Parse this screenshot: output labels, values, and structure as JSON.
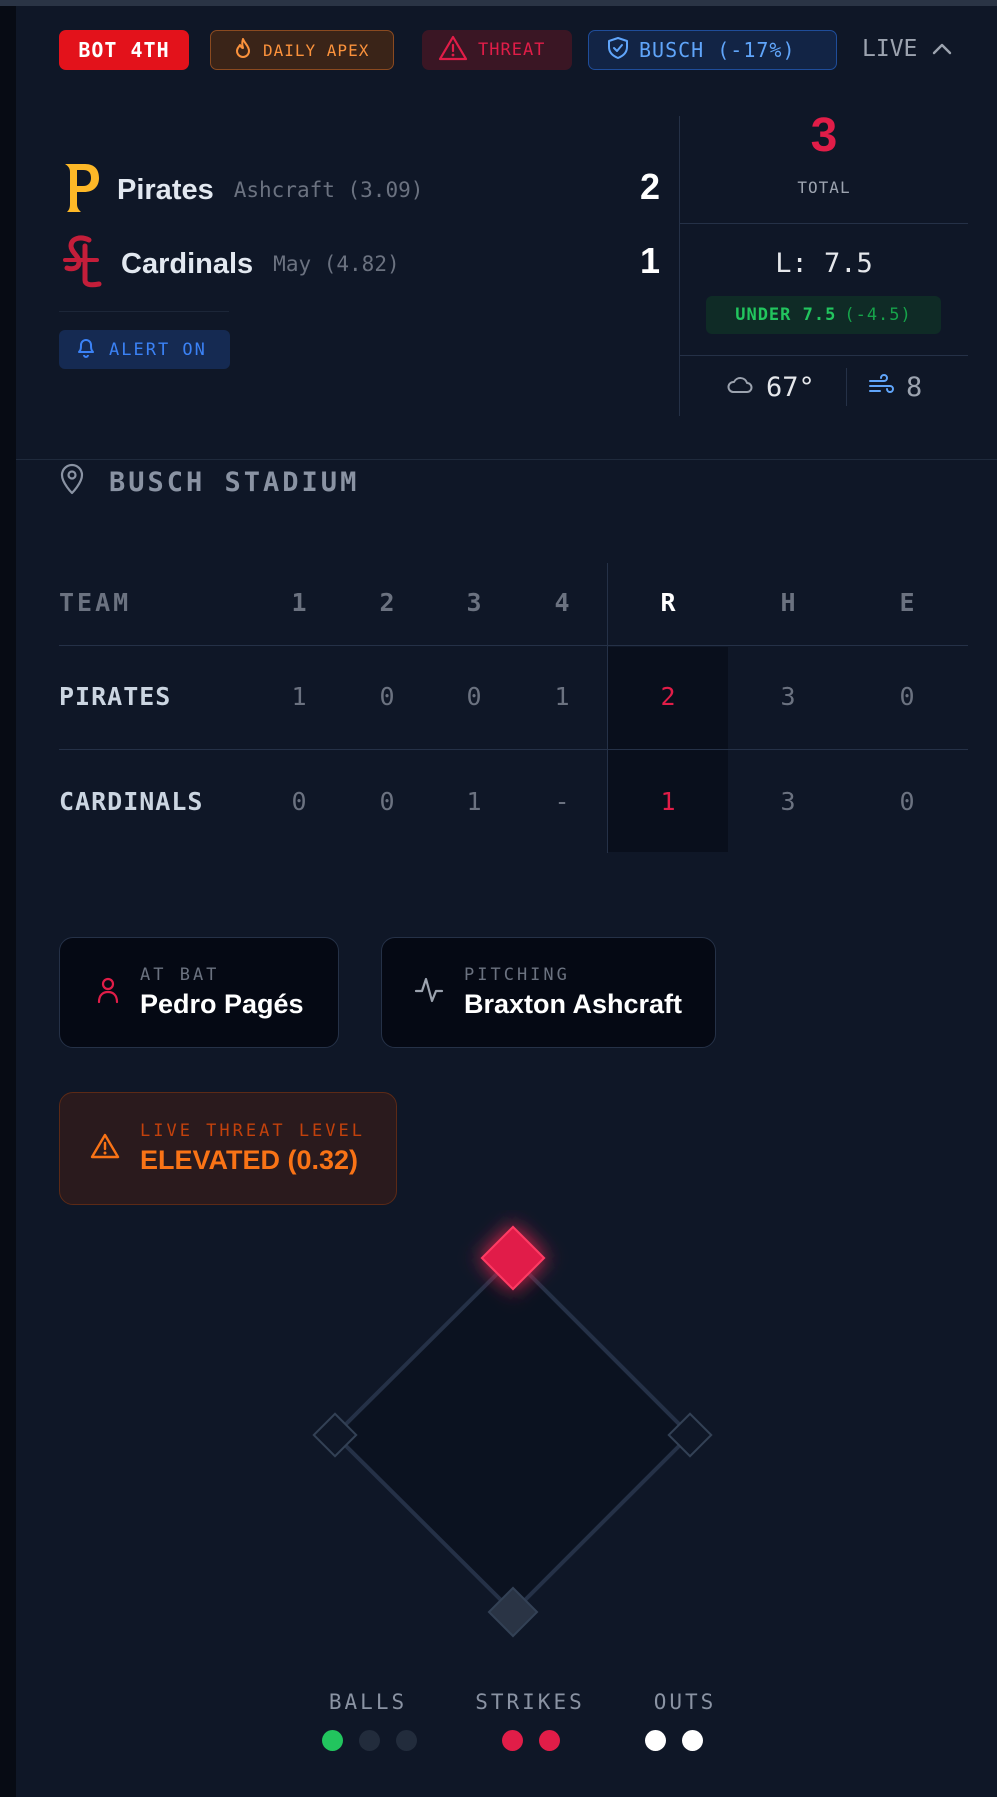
{
  "header": {
    "inning": "BOT 4TH",
    "apex_label": "DAILY APEX",
    "threat_label": "THREAT",
    "park_label": "BUSCH (-17%)",
    "live_label": "LIVE"
  },
  "teams": [
    {
      "name": "Pirates",
      "pitcher": "Ashcraft (3.09)",
      "score": "2",
      "logo_color": "#fdb827"
    },
    {
      "name": "Cardinals",
      "pitcher": "May (4.82)",
      "score": "1",
      "logo_color": "#c41e3a"
    }
  ],
  "alert_label": "ALERT ON",
  "total": {
    "value": "3",
    "label": "TOTAL"
  },
  "line": {
    "value": "L: 7.5",
    "under_label": "UNDER 7.5",
    "under_diff": "(-4.5)"
  },
  "weather": {
    "temp": "67°",
    "wind": "8"
  },
  "stadium": "BUSCH STADIUM",
  "box_score": {
    "headers": [
      "TEAM",
      "1",
      "2",
      "3",
      "4",
      "R",
      "H",
      "E"
    ],
    "rows": [
      {
        "team": "PIRATES",
        "innings": [
          "1",
          "0",
          "0",
          "1"
        ],
        "r": "2",
        "h": "3",
        "e": "0"
      },
      {
        "team": "CARDINALS",
        "innings": [
          "0",
          "0",
          "1",
          "-"
        ],
        "r": "1",
        "h": "3",
        "e": "0"
      }
    ]
  },
  "at_bat": {
    "label": "AT BAT",
    "name": "Pedro Pagés"
  },
  "pitching": {
    "label": "PITCHING",
    "name": "Braxton Ashcraft"
  },
  "threat_level": {
    "label": "LIVE THREAT LEVEL",
    "value": "ELEVATED (0.32)"
  },
  "bases": {
    "first": false,
    "second": true,
    "third": false
  },
  "count": {
    "balls_label": "BALLS",
    "strikes_label": "STRIKES",
    "outs_label": "OUTS",
    "balls": 1,
    "strikes": 2,
    "outs": 2
  },
  "colors": {
    "live_red": "#e3121b",
    "accent_red": "#e11d48",
    "green": "#22c55e",
    "blue": "#60a5fa",
    "orange": "#f97316"
  }
}
